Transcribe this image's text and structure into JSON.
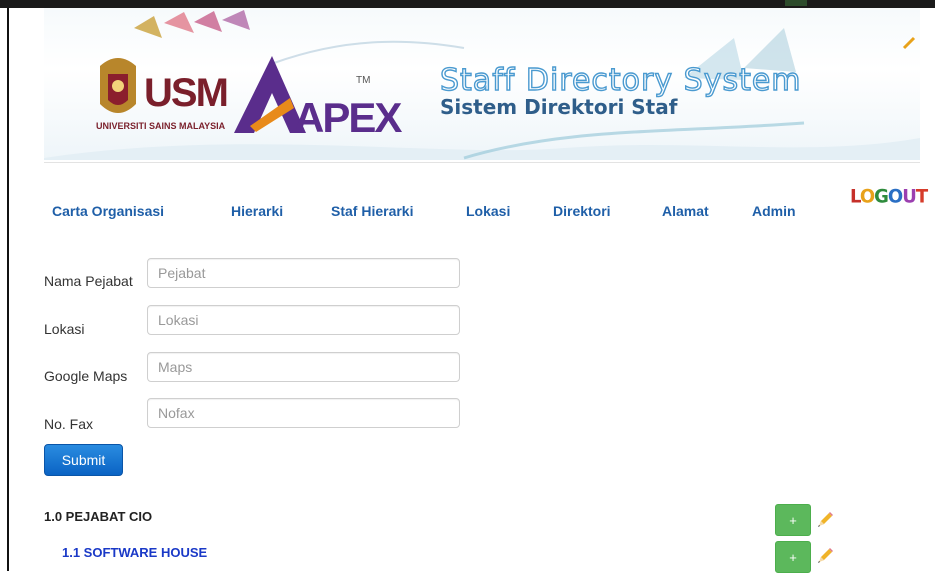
{
  "banner": {
    "university_name": "UNIVERSITI SAINS MALAYSIA",
    "university_abbr": "USM",
    "apex_logo": "APEX",
    "apex_tm": "TM",
    "title_en": "Staff Directory System",
    "title_ms": "Sistem Direktori Staf"
  },
  "nav": {
    "items": [
      {
        "label": "Carta Organisasi"
      },
      {
        "label": "Hierarki"
      },
      {
        "label": "Staf Hierarki"
      },
      {
        "label": "Lokasi"
      },
      {
        "label": "Direktori"
      },
      {
        "label": "Alamat"
      },
      {
        "label": "Admin"
      }
    ],
    "logout_label": "LOGOUT"
  },
  "form": {
    "office_name": {
      "label": "Nama Pejabat",
      "placeholder": "Pejabat",
      "value": ""
    },
    "location": {
      "label": "Lokasi",
      "placeholder": "Lokasi",
      "value": ""
    },
    "google_maps": {
      "label": "Google Maps",
      "placeholder": "Maps",
      "value": ""
    },
    "fax": {
      "label": "No. Fax",
      "placeholder": "Nofax",
      "value": ""
    },
    "submit_label": "Submit"
  },
  "org_list": [
    {
      "label": "1.0 PEJABAT CIO",
      "add_label": "+",
      "edit_icon": "pencil-icon"
    },
    {
      "label": "1.1 SOFTWARE HOUSE",
      "add_label": "+",
      "edit_icon": "pencil-icon"
    }
  ],
  "colors": {
    "nav_link": "#1f5fa8",
    "submit": "#0a63c4",
    "add_button": "#5cb85c",
    "sub_item": "#1a39c7"
  }
}
